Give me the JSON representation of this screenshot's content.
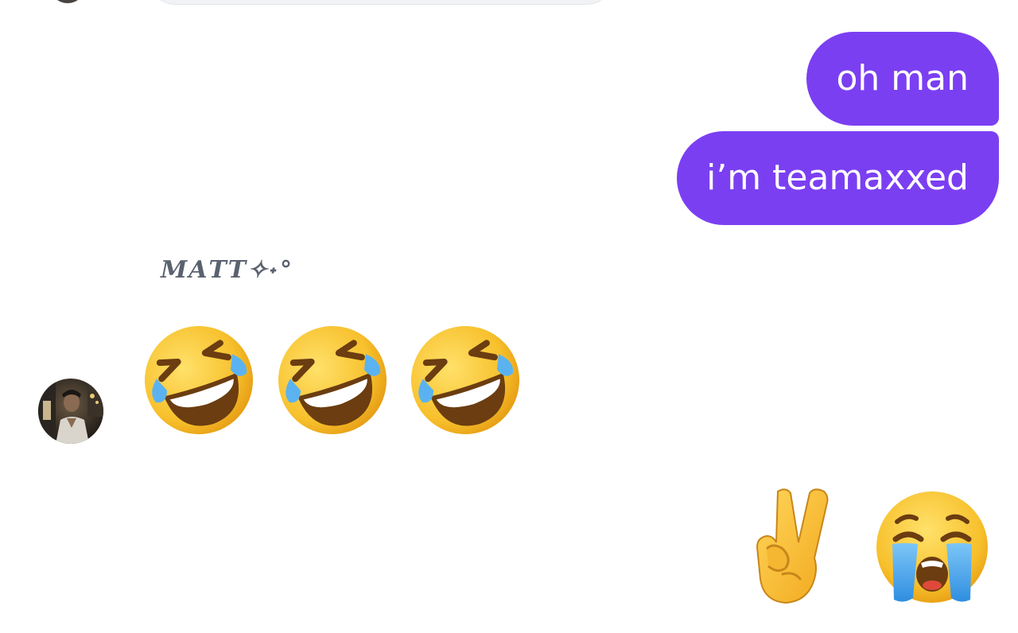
{
  "conversation": {
    "outgoing_messages": [
      {
        "text": "oh man"
      },
      {
        "text": "i’m teamaxxed"
      }
    ],
    "incoming": {
      "sender_name": "𝑴𝑨𝑻𝑻✧˖°",
      "reactions": [
        "rolling-on-floor-laughing",
        "rolling-on-floor-laughing",
        "rolling-on-floor-laughing"
      ]
    },
    "outgoing_reactions": [
      "victory-hand",
      "loudly-crying-face"
    ]
  },
  "colors": {
    "outgoing_bubble": "#7b3ff2",
    "outgoing_text": "#ffffff",
    "sender_name": "#5a6270",
    "background": "#ffffff"
  },
  "icons": {
    "laugh": "rolling-on-floor-laughing-emoji",
    "victory": "victory-hand-emoji",
    "crying": "loudly-crying-face-emoji"
  }
}
